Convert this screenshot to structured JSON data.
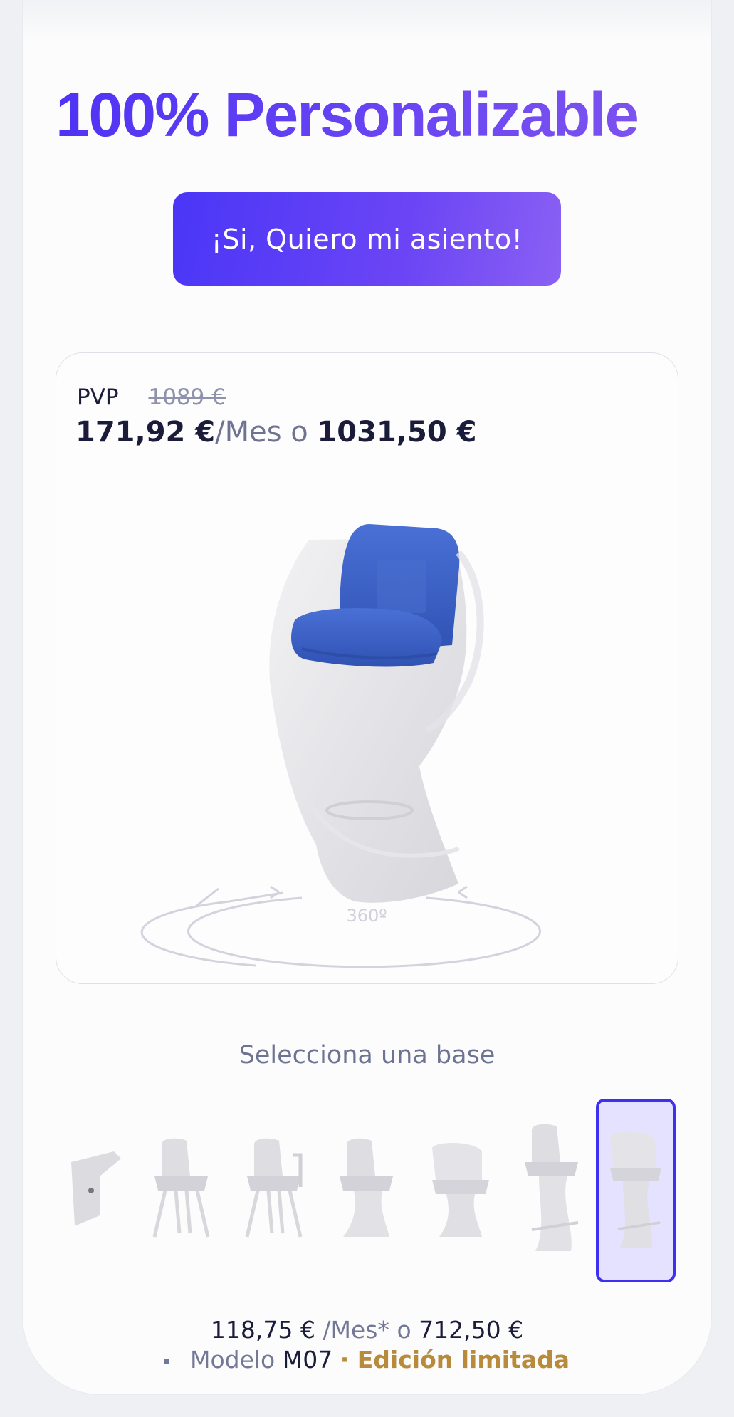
{
  "hero": {
    "title": "100% Personalizable"
  },
  "cta": {
    "label": "¡Si, Quiero mi asiento!"
  },
  "card": {
    "pvp_label": "PVP",
    "old_price": "1089 €",
    "monthly_price": "171,92 €",
    "per_month": "/Mes o",
    "full_price": "1031,50 €",
    "rotate_label": "360º"
  },
  "selector": {
    "label": "Selecciona una base",
    "selected_index": 6,
    "bases": [
      "wall-mount",
      "four-leg-chair",
      "four-leg-armchair",
      "pedestal",
      "armchair-pedestal",
      "tall-stool",
      "tall-armchair-stool"
    ]
  },
  "summary": {
    "monthly": "118,75 €",
    "per_month": "/Mes*",
    "or": "o",
    "full": "712,50 €",
    "model_label": "Modelo",
    "model_code": "M07",
    "edition": "· Edición limitada"
  },
  "colors": {
    "accent": "#4a36f7",
    "seat_blue": "#3f65c8",
    "gold": "#b78a3c"
  }
}
